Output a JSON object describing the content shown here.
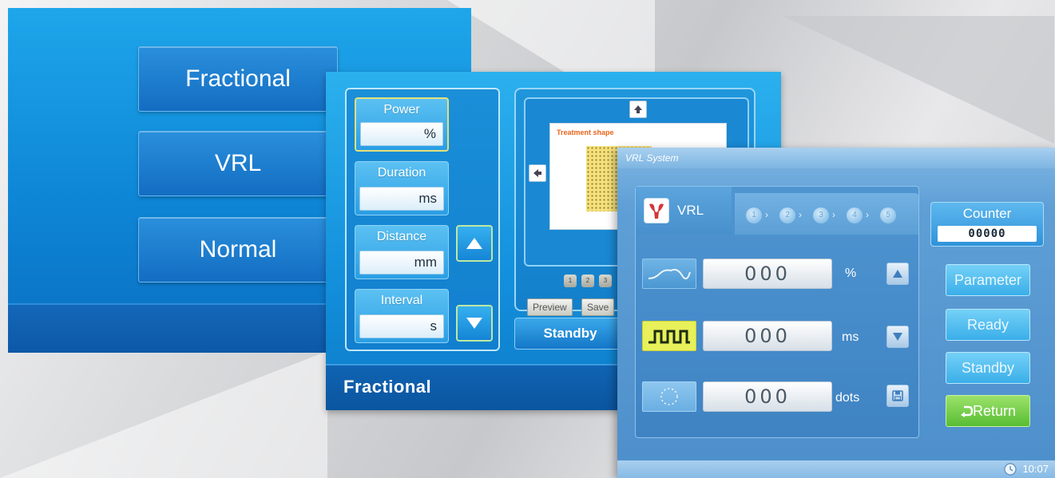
{
  "mode_screen": {
    "buttons": [
      "Fractional",
      "VRL",
      "Normal"
    ]
  },
  "fractional_screen": {
    "params": [
      {
        "label": "Power",
        "value": "%"
      },
      {
        "label": "Duration",
        "value": "ms"
      },
      {
        "label": "Distance",
        "value": "mm"
      },
      {
        "label": "Interval",
        "value": "s"
      }
    ],
    "preview": {
      "shape_title": "Treatment shape",
      "pages": [
        "1",
        "2",
        "3"
      ],
      "preview_label": "Preview",
      "save_label": "Save"
    },
    "standby_label": "Standby",
    "footer_title": "Fractional"
  },
  "vrl_screen": {
    "title": "VRL System",
    "tab_label": "VRL",
    "steps": [
      "1",
      "2",
      "3",
      "4",
      "5"
    ],
    "rows": [
      {
        "value": "000",
        "unit": "%"
      },
      {
        "value": "000",
        "unit": "ms"
      },
      {
        "value": "000",
        "unit": "dots"
      }
    ],
    "counter": {
      "label": "Counter",
      "value": "00000"
    },
    "buttons": {
      "parameter": "Parameter",
      "ready": "Ready",
      "standby": "Standby",
      "return": "Return"
    },
    "clock": "10:07"
  },
  "colors": {
    "accent_blue": "#1390dc",
    "return_green": "#58bd34",
    "pulse_icon_bg": "#e8f05a"
  }
}
